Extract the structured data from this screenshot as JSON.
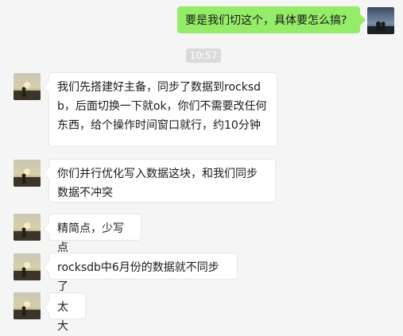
{
  "chat": {
    "timestamp": "10:57",
    "messages": [
      {
        "sender": "self",
        "text": "要是我们切这个，具体要怎么搞?"
      },
      {
        "sender": "other",
        "text": "我们先搭建好主备，同步了数据到rocksdb，后面切换一下就ok，你们不需要改任何东西，给个操作时间窗口就行，约10分钟"
      },
      {
        "sender": "other",
        "text": "你们并行优化写入数据这块，和我们同步数据不冲突"
      },
      {
        "sender": "other",
        "text": "精简点，少写点"
      },
      {
        "sender": "other",
        "text": "rocksdb中6月份的数据就不同步了"
      },
      {
        "sender": "other",
        "text": "太大"
      }
    ]
  },
  "avatars": {
    "self_icon": "avatar-night-sky",
    "other_icon": "avatar-sunset-silhouette"
  },
  "colors": {
    "background": "#f5f5f5",
    "self_bubble": "#95ec69",
    "other_bubble": "#ffffff",
    "timestamp_bg": "#dadada"
  }
}
